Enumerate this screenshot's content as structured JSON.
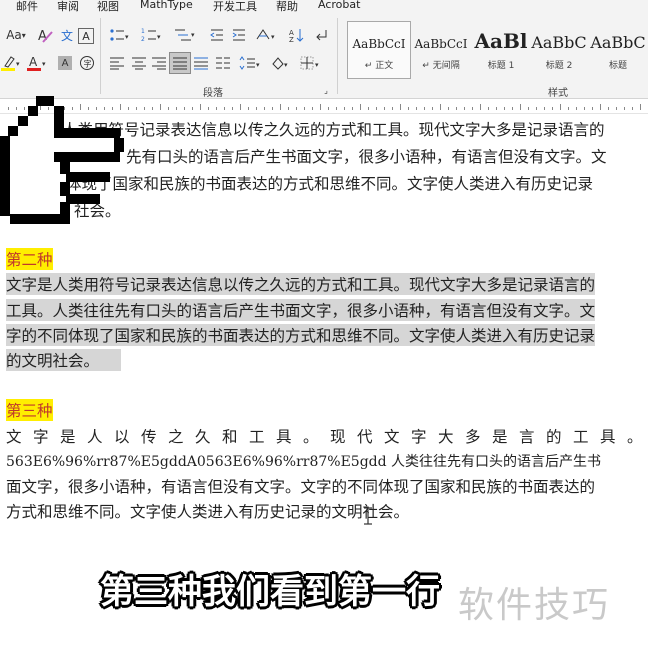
{
  "menu": {
    "items": [
      "邮件",
      "审阅",
      "视图",
      "MathType",
      "开发工具",
      "帮助",
      "Acrobat"
    ]
  },
  "ribbon": {
    "font_size_label": "Aa",
    "wen_label": "文",
    "a_label": "A",
    "groups": {
      "paragraph": "段落",
      "styles": "样式"
    },
    "styles": [
      {
        "preview": "AaBbCcI",
        "name": "↵ 正文"
      },
      {
        "preview": "AaBbCcI",
        "name": "↵ 无间隔"
      },
      {
        "preview": "AaBl",
        "name": "标题 1"
      },
      {
        "preview": "AaBbC",
        "name": "标题 2"
      },
      {
        "preview": "AaBbC",
        "name": "标题"
      }
    ],
    "colors": {
      "highlight": "#ffee00",
      "font_color": "#e02020"
    }
  },
  "document": {
    "para1": [
      "人类用符号记录表达信息以传之久远的方式和工具。现代文字大多是记录语言的",
      "先有口头的语言后产生书面文字，很多小语种，有语言但没有文字。文",
      "体现了国家和民族的书面表达的方式和思维不同。文字使人类进入有历史记录",
      "社会。"
    ],
    "heading2": "第二种",
    "para2": [
      "文字是人类用符号记录表达信息以传之久远的方式和工具。现代文字大多是记录语言的",
      "工具。人类往往先有口头的语言后产生书面文字，很多小语种，有语言但没有文字。文",
      "字的不同体现了国家和民族的书面表达的方式和思维不同。文字使人类进入有历史记录",
      "的文明社会。"
    ],
    "heading3": "第三种",
    "para3": [
      "文字是人以传之久和工具。现代文字大多是言的工具。",
      "563E6%96%rr87%E5gddA0563E6%96%rr87%E5gdd 人类往往先有口头的语言后产生书",
      "面文字，很多小语种，有语言但没有文字。文字的不同体现了国家和民族的书面表达的",
      "方式和思维不同。文字使人类进入有历史记录的文明社会。"
    ]
  },
  "overlay": {
    "subtitle": "第三种我们看到第一行",
    "watermark": "软件技巧"
  }
}
